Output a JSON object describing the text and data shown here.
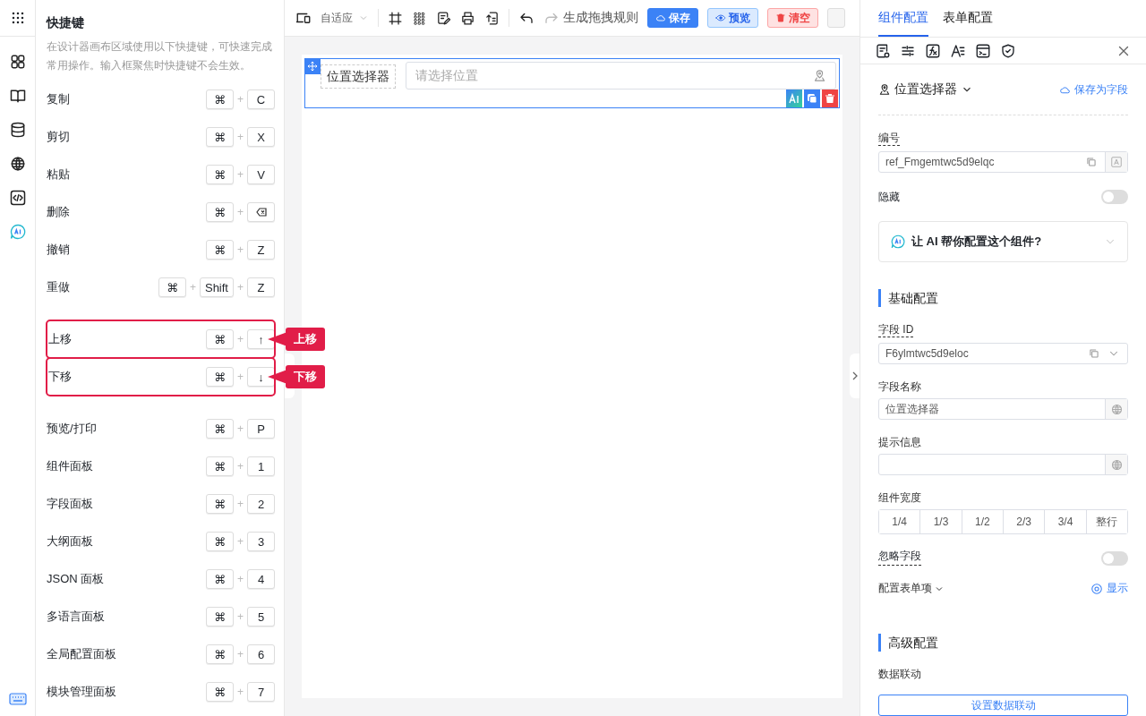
{
  "shortcuts": {
    "title": "快捷键",
    "description": "在设计器画布区域使用以下快捷键，可快速完成常用操作。输入框聚焦时快捷键不会生效。",
    "separator": "+",
    "groups": [
      {
        "items": [
          {
            "label": "复制",
            "keys": [
              {
                "kind": "text",
                "text": "⌘"
              },
              {
                "kind": "text",
                "text": "C"
              }
            ],
            "highlighted": false
          },
          {
            "label": "剪切",
            "keys": [
              {
                "kind": "text",
                "text": "⌘"
              },
              {
                "kind": "text",
                "text": "X"
              }
            ],
            "highlighted": false
          },
          {
            "label": "粘贴",
            "keys": [
              {
                "kind": "text",
                "text": "⌘"
              },
              {
                "kind": "text",
                "text": "V"
              }
            ],
            "highlighted": false
          },
          {
            "label": "删除",
            "keys": [
              {
                "kind": "text",
                "text": "⌘"
              },
              {
                "kind": "backspace"
              }
            ],
            "highlighted": false
          },
          {
            "label": "撤销",
            "keys": [
              {
                "kind": "text",
                "text": "⌘"
              },
              {
                "kind": "text",
                "text": "Z"
              }
            ],
            "highlighted": false
          },
          {
            "label": "重做",
            "keys": [
              {
                "kind": "text",
                "text": "⌘"
              },
              {
                "kind": "text",
                "text": "Shift"
              },
              {
                "kind": "text",
                "text": "Z"
              }
            ],
            "highlighted": false
          }
        ]
      },
      {
        "items": [
          {
            "label": "上移",
            "keys": [
              {
                "kind": "text",
                "text": "⌘"
              },
              {
                "kind": "text",
                "text": "↑"
              }
            ],
            "highlighted": true,
            "callout": "上移"
          },
          {
            "label": "下移",
            "keys": [
              {
                "kind": "text",
                "text": "⌘"
              },
              {
                "kind": "text",
                "text": "↓"
              }
            ],
            "highlighted": true,
            "callout": "下移"
          }
        ]
      },
      {
        "items": [
          {
            "label": "预览/打印",
            "keys": [
              {
                "kind": "text",
                "text": "⌘"
              },
              {
                "kind": "text",
                "text": "P"
              }
            ],
            "highlighted": false
          },
          {
            "label": "组件面板",
            "keys": [
              {
                "kind": "text",
                "text": "⌘"
              },
              {
                "kind": "text",
                "text": "1"
              }
            ],
            "highlighted": false
          },
          {
            "label": "字段面板",
            "keys": [
              {
                "kind": "text",
                "text": "⌘"
              },
              {
                "kind": "text",
                "text": "2"
              }
            ],
            "highlighted": false
          },
          {
            "label": "大纲面板",
            "keys": [
              {
                "kind": "text",
                "text": "⌘"
              },
              {
                "kind": "text",
                "text": "3"
              }
            ],
            "highlighted": false
          },
          {
            "label": "JSON 面板",
            "keys": [
              {
                "kind": "text",
                "text": "⌘"
              },
              {
                "kind": "text",
                "text": "4"
              }
            ],
            "highlighted": false
          },
          {
            "label": "多语言面板",
            "keys": [
              {
                "kind": "text",
                "text": "⌘"
              },
              {
                "kind": "text",
                "text": "5"
              }
            ],
            "highlighted": false
          },
          {
            "label": "全局配置面板",
            "keys": [
              {
                "kind": "text",
                "text": "⌘"
              },
              {
                "kind": "text",
                "text": "6"
              }
            ],
            "highlighted": false
          },
          {
            "label": "模块管理面板",
            "keys": [
              {
                "kind": "text",
                "text": "⌘"
              },
              {
                "kind": "text",
                "text": "7"
              }
            ],
            "highlighted": false
          }
        ]
      }
    ]
  },
  "toolbar": {
    "layout_mode": "自适应",
    "redo_disabled": true,
    "generate_rule": "生成拖拽规则",
    "buttons": [
      {
        "label": "保存",
        "kind": "primary"
      },
      {
        "label": "预览",
        "kind": "secondary"
      },
      {
        "label": "清空",
        "kind": "danger"
      }
    ]
  },
  "canvas": {
    "field": {
      "label": "位置选择器",
      "placeholder": "请选择位置",
      "selected": true
    }
  },
  "right_panel": {
    "tabs": [
      {
        "label": "组件配置",
        "selected": true
      },
      {
        "label": "表单配置",
        "selected": false
      }
    ],
    "component": {
      "name": "位置选择器",
      "save_as_field": "保存为字段"
    },
    "ref": {
      "label": "编号",
      "value": "ref_Fmgemtwc5d9elqc"
    },
    "hidden": {
      "label": "隐藏",
      "on": false
    },
    "ai_prompt": "让 AI 帮你配置这个组件?",
    "basic_title": "基础配置",
    "field_id": {
      "label": "字段 ID",
      "value": "F6ylmtwc5d9eloc"
    },
    "field_name": {
      "label": "字段名称",
      "value": "位置选择器"
    },
    "hint": {
      "label": "提示信息"
    },
    "width": {
      "label": "组件宽度",
      "options": [
        {
          "label": "1/4",
          "selected": false
        },
        {
          "label": "1/3",
          "selected": false
        },
        {
          "label": "1/2",
          "selected": false
        },
        {
          "label": "2/3",
          "selected": false
        },
        {
          "label": "3/4",
          "selected": false
        },
        {
          "label": "整行",
          "selected": false
        }
      ]
    },
    "ignore": {
      "label": "忽略字段",
      "on": false
    },
    "form_items": {
      "label": "配置表单项",
      "action": "显示"
    },
    "advanced_title": "高级配置",
    "linkage": {
      "label": "数据联动",
      "button": "设置数据联动"
    }
  }
}
